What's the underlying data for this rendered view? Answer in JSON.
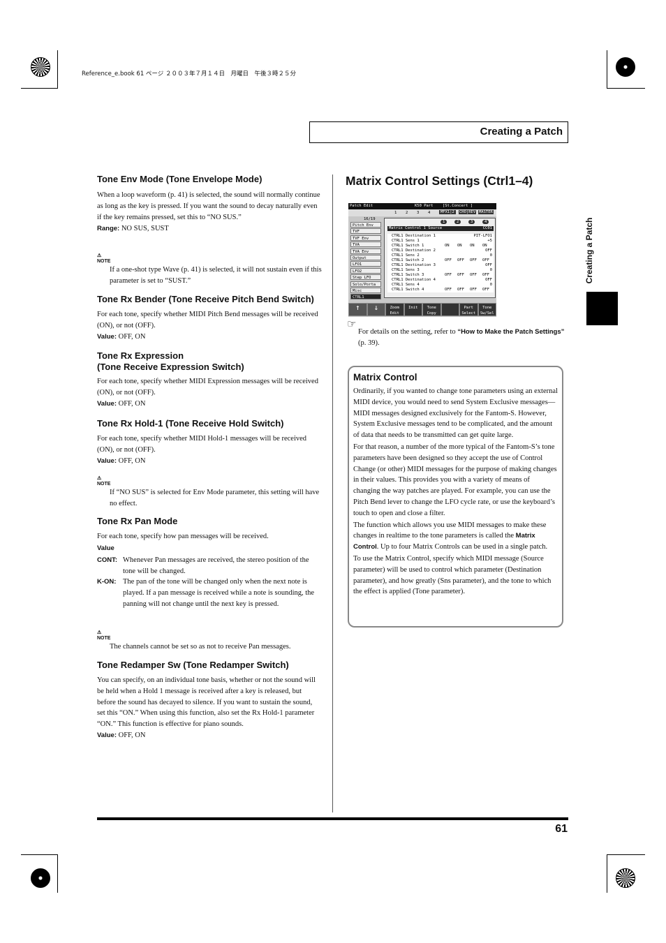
{
  "print_header": "Reference_e.book  61 ページ  ２００３年７月１４日　月曜日　午後３時２５分",
  "chapter_title": "Creating a Patch",
  "side_tab": "Creating a Patch",
  "page_number": "61",
  "left": {
    "env_mode": {
      "heading": "Tone Env Mode (Tone Envelope Mode)",
      "text": "When a loop waveform (p. 41) is selected, the sound will normally continue as long as the key is pressed. If you want the sound to decay naturally even if the key remains pressed, set this to “NO SUS.”",
      "range_label": "Range:",
      "range": " NO SUS, SUST",
      "note_label": "NOTE",
      "note": "If a one-shot type Wave (p. 41) is selected, it will not sustain even if this parameter is set to “SUST.”"
    },
    "rx_bender": {
      "heading": "Tone Rx Bender (Tone Receive Pitch Bend Switch)",
      "text": "For each tone, specify whether MIDI Pitch Bend messages will be received (ON), or not (OFF).",
      "value_label": "Value:",
      "value": " OFF, ON"
    },
    "rx_expression": {
      "heading1": "Tone Rx Expression",
      "heading2": "(Tone Receive Expression Switch)",
      "text": "For each tone, specify whether MIDI Expression messages will be received (ON), or not (OFF).",
      "value_label": "Value:",
      "value": " OFF, ON"
    },
    "rx_hold": {
      "heading": "Tone Rx Hold-1 (Tone Receive Hold Switch)",
      "text": "For each tone, specify whether MIDI Hold-1 messages will be received (ON), or not (OFF).",
      "value_label": "Value:",
      "value": " OFF, ON",
      "note_label": "NOTE",
      "note": "If “NO SUS” is selected for Env Mode parameter, this setting will have no effect."
    },
    "rx_pan": {
      "heading": "Tone Rx Pan Mode",
      "text": "For each tone, specify how pan messages will be received.",
      "value_label": "Value",
      "items": [
        {
          "term": "CONT:",
          "desc": "Whenever Pan messages are received, the stereo position of the tone will be changed."
        },
        {
          "term": "K-ON:",
          "desc": "The pan of the tone will be changed only when the next note is played. If a pan message is received while a note is sounding, the panning will not change until the next key is pressed."
        }
      ],
      "note_label": "NOTE",
      "note": "The channels cannot be set so as not to receive Pan messages."
    },
    "redamper": {
      "heading": "Tone Redamper Sw (Tone Redamper Switch)",
      "text": "You can specify, on an individual tone basis, whether or not the sound will be held when a Hold 1 message is received after a key is released, but before the sound has decayed to silence. If you want to sustain the sound, set this “ON.” When using this function, also set the Rx Hold-1 parameter “ON.” This function is effective for piano sounds.",
      "value_label": "Value:",
      "value": " OFF, ON"
    }
  },
  "right": {
    "title": "Matrix Control Settings (Ctrl1–4)",
    "lcd": {
      "title": "Patch Edit",
      "part": "K50 Part",
      "patch": "[St.Concert  ]",
      "tone_switches": [
        "1",
        "2",
        "3",
        "4"
      ],
      "tabs": [
        "MFX1|2",
        "CHO|REV",
        "MASTER"
      ],
      "page": "16/19",
      "sidebar": [
        "Pitch Env",
        "TVF",
        "TVF Env",
        "TVA",
        "TVA Env",
        "Output",
        "LFO1",
        "LFO2",
        "Step LFO",
        "Solo/Porta",
        "Misc",
        "CTRL1"
      ],
      "tone_icons": [
        "1",
        "2",
        "3",
        "4"
      ],
      "source_label": "Matrix Control 1 Source",
      "source_value": "CC01",
      "groups": [
        {
          "dest": "CTRL1 Destination 1",
          "dest_val": "PIT-LFO1",
          "sens": "CTRL1 Sens 1",
          "sens_val": "+5",
          "switch": "CTRL1 Switch 1",
          "sw": [
            "ON",
            "ON",
            "ON",
            "ON"
          ]
        },
        {
          "dest": "CTRL1 Destination 2",
          "dest_val": "OFF",
          "sens": "CTRL1 Sens 2",
          "sens_val": "0",
          "switch": "CTRL1 Switch 2",
          "sw": [
            "OFF",
            "OFF",
            "OFF",
            "OFF"
          ]
        },
        {
          "dest": "CTRL1 Destination 3",
          "dest_val": "OFF",
          "sens": "CTRL1 Sens 3",
          "sens_val": "0",
          "switch": "CTRL1 Switch 3",
          "sw": [
            "OFF",
            "OFF",
            "OFF",
            "OFF"
          ]
        },
        {
          "dest": "CTRL1 Destination 4",
          "dest_val": "OFF",
          "sens": "CTRL1 Sens 4",
          "sens_val": "0",
          "switch": "CTRL1 Switch 4",
          "sw": [
            "OFF",
            "OFF",
            "OFF",
            "OFF"
          ]
        }
      ],
      "buttons": [
        "↑",
        "↓",
        "Zoom Edit",
        "Init",
        "Tone Copy",
        "",
        "Part Select",
        "Tone Sw/Sel"
      ]
    },
    "ref_pre": "For details on the setting, refer to ",
    "ref_bold": "“How to Make the Patch Settings”",
    "ref_post": " (p. 39).",
    "box": {
      "heading": "Matrix Control",
      "p1": "Ordinarily, if you wanted to change tone parameters using an external MIDI device, you would need to send System Exclusive messages—MIDI messages designed exclusively for the Fantom-S. However, System Exclusive messages tend to be complicated, and the amount of data that needs to be transmitted can get quite large.",
      "p2": "For that reason, a number of the more typical of the Fantom-S’s tone parameters have been designed so they accept the use of Control Change (or other) MIDI messages for the purpose of making changes in their values. This provides you with a variety of means of changing the way patches are played. For example, you can use the Pitch Bend lever to change the LFO cycle rate, or use the keyboard’s touch to open and close a filter.",
      "p3_pre": "The function which allows you use MIDI messages to make these changes in realtime to the tone parameters is called the ",
      "p3_bold": "Matrix Control",
      "p3_post": ". Up to four Matrix Controls can be used in a single patch.",
      "p4": "To use the Matrix Control, specify which MIDI message (Source parameter) will be used to control which parameter (Destination parameter), and how greatly (Sns parameter), and the tone to which the effect is applied (Tone parameter)."
    }
  }
}
